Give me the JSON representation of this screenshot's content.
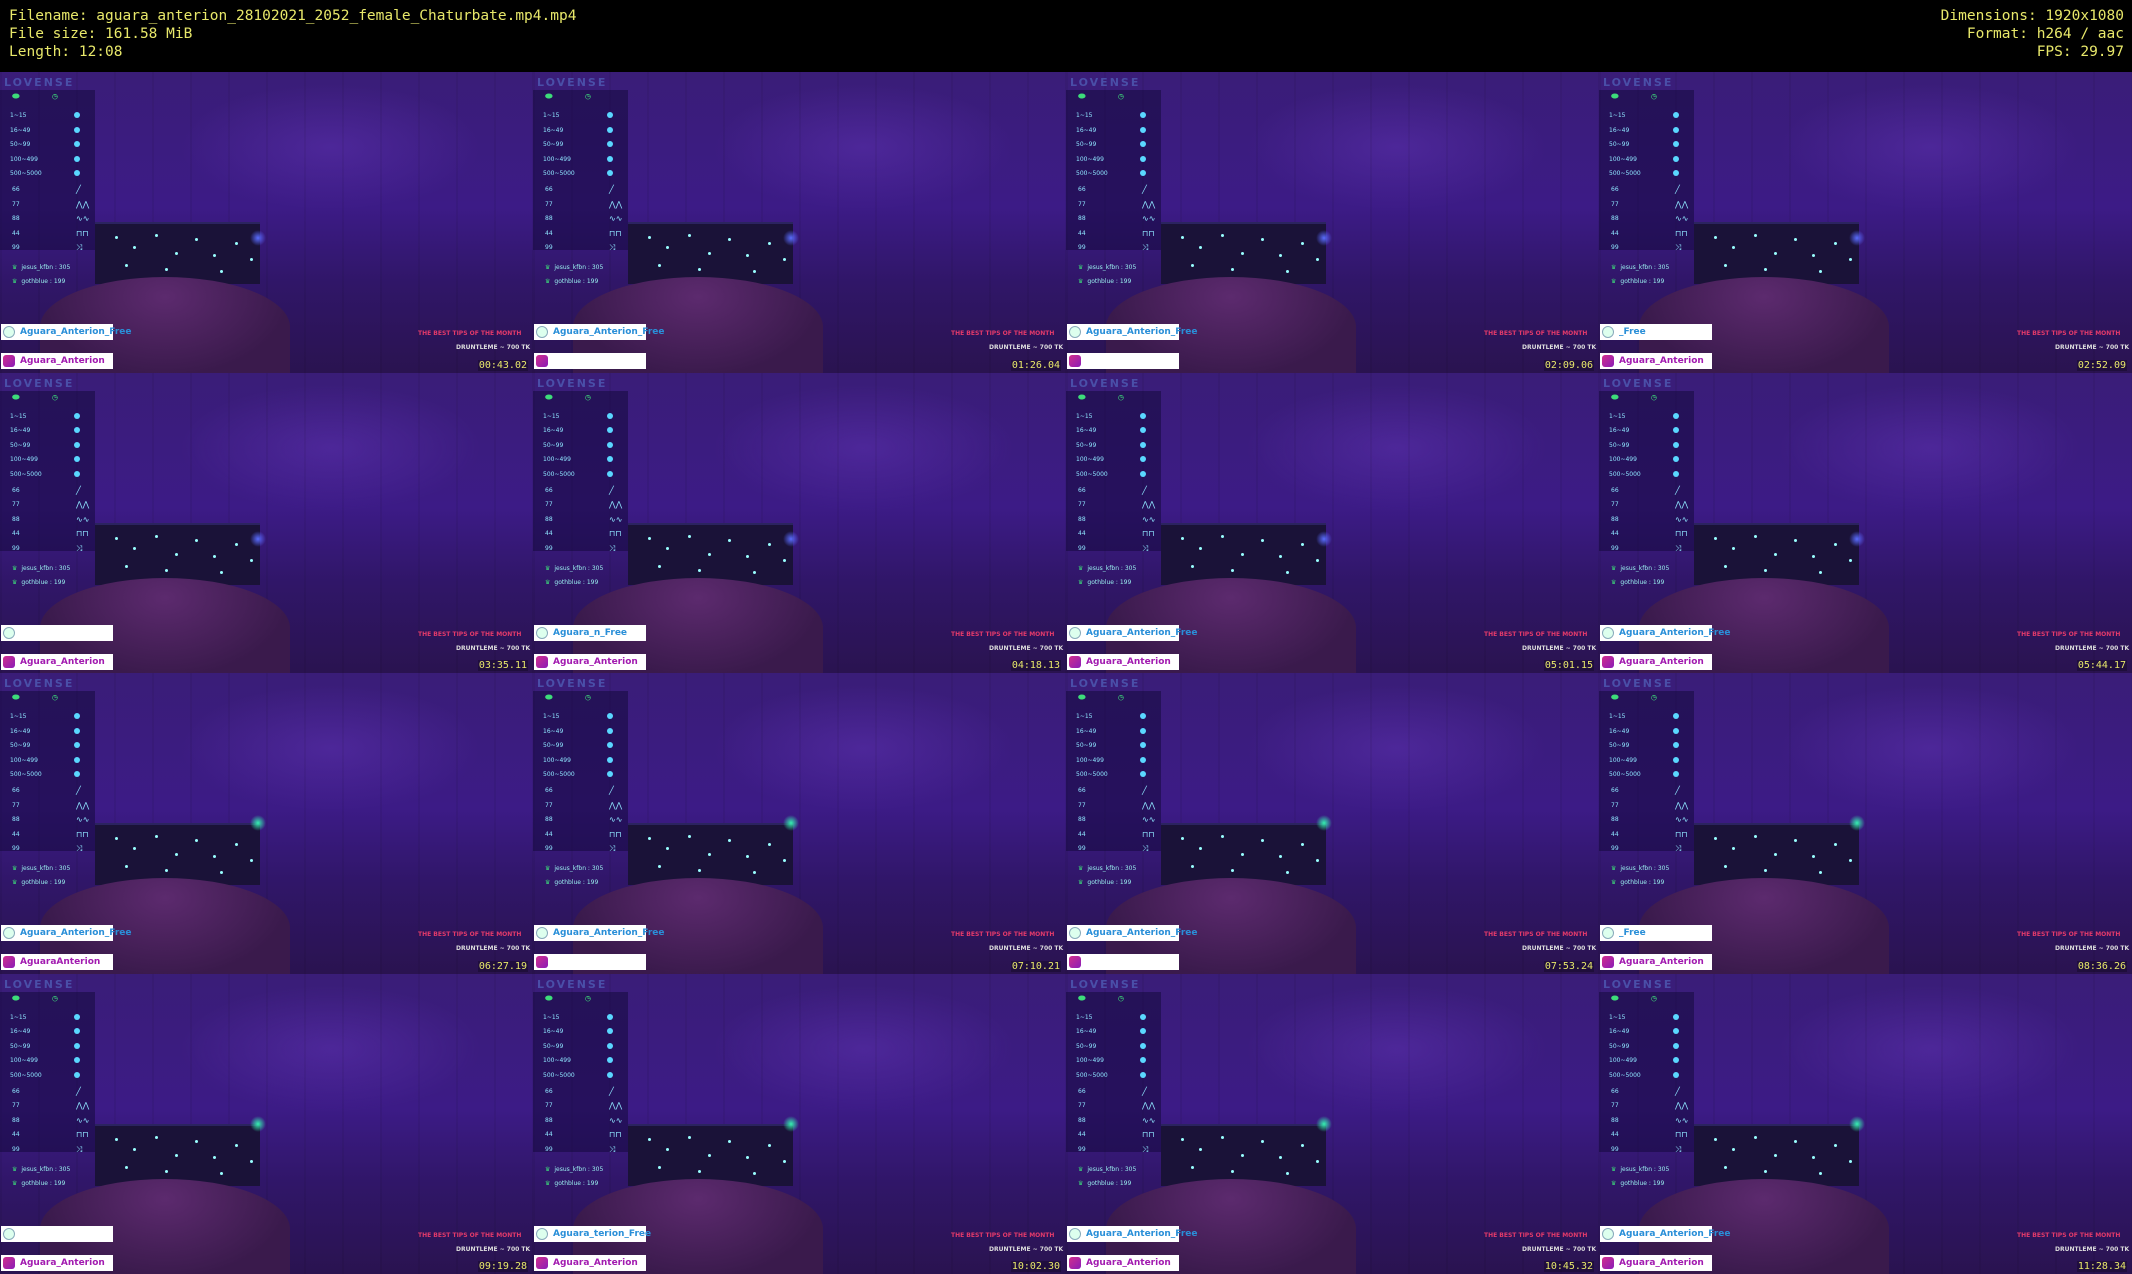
{
  "header": {
    "filename": "Filename: aguara_anterion_28102021_2052_female_Chaturbate.mp4.mp4",
    "filesize": "File size: 161.58 MiB",
    "length": "Length: 12:08",
    "dimensions": "Dimensions: 1920x1080",
    "format": "Format: h264 / aac",
    "fps": "FPS: 29.97"
  },
  "overlay": {
    "brand": "LOVENSE",
    "tiers": [
      "1~15",
      "16~49",
      "50~99",
      "100~499",
      "500~5000"
    ],
    "patterns": [
      "66",
      "77",
      "88",
      "44",
      "99"
    ],
    "leader1": "jesus_kfbn : 305",
    "leader2": "gothblue : 199",
    "promo": "THE BEST TIPS OF THE MONTH",
    "promo2": "DRUNTLEME ~ 700 TK"
  },
  "thumbs": [
    {
      "time": "00:43.02",
      "top_tag": "Aguara_Anterion_Free",
      "bottom_tag": "Aguara_Anterion",
      "glow": "blue"
    },
    {
      "time": "01:26.04",
      "top_tag": "Aguara_Anterion_Free",
      "bottom_tag": "",
      "glow": "blue"
    },
    {
      "time": "02:09.06",
      "top_tag": "Aguara_Anterion_Free",
      "bottom_tag": "",
      "glow": "blue"
    },
    {
      "time": "02:52.09",
      "top_tag": "_Free",
      "bottom_tag": "Aguara_Anterion",
      "glow": "blue"
    },
    {
      "time": "03:35.11",
      "top_tag": "",
      "bottom_tag": "Aguara_Anterion",
      "glow": "blue"
    },
    {
      "time": "04:18.13",
      "top_tag": "Aguara_n_Free",
      "bottom_tag": "Aguara_Anterion",
      "glow": "blue"
    },
    {
      "time": "05:01.15",
      "top_tag": "Aguara_Anterion_Free",
      "bottom_tag": "Aguara_Anterion",
      "glow": "blue"
    },
    {
      "time": "05:44.17",
      "top_tag": "Aguara_Anterion_Free",
      "bottom_tag": "Aguara_Anterion",
      "glow": "blue"
    },
    {
      "time": "06:27.19",
      "top_tag": "Aguara_Anterion_Free",
      "bottom_tag": "AguaraAnterion",
      "glow": "green"
    },
    {
      "time": "07:10.21",
      "top_tag": "Aguara_Anterion_Free",
      "bottom_tag": "",
      "glow": "green"
    },
    {
      "time": "07:53.24",
      "top_tag": "Aguara_Anterion_Free",
      "bottom_tag": "",
      "glow": "green"
    },
    {
      "time": "08:36.26",
      "top_tag": "_Free",
      "bottom_tag": "Aguara_Anterion",
      "glow": "green"
    },
    {
      "time": "09:19.28",
      "top_tag": "",
      "bottom_tag": "Aguara_Anterion",
      "glow": "green"
    },
    {
      "time": "10:02.30",
      "top_tag": "Aguara_terion_Free",
      "bottom_tag": "Aguara_Anterion",
      "glow": "green"
    },
    {
      "time": "10:45.32",
      "top_tag": "Aguara_Anterion_Free",
      "bottom_tag": "Aguara_Anterion",
      "glow": "green"
    },
    {
      "time": "11:28.34",
      "top_tag": "Aguara_Anterion_Free",
      "bottom_tag": "Aguara_Anterion",
      "glow": "green"
    }
  ]
}
